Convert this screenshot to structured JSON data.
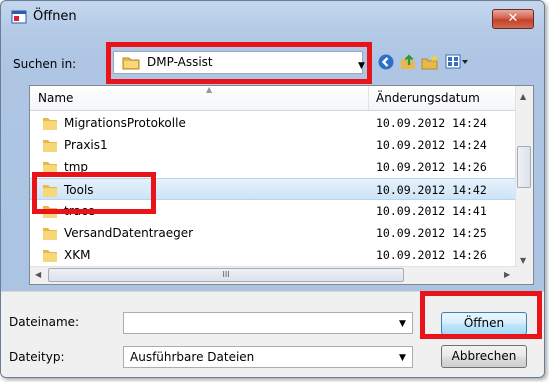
{
  "window": {
    "title": "Öffnen",
    "close_glyph": "✕"
  },
  "lookin": {
    "label": "Suchen in:",
    "value": "DMP-Assist"
  },
  "toolbar": {
    "icons": [
      "back-icon",
      "up-folder-icon",
      "new-folder-icon",
      "view-menu-icon"
    ]
  },
  "list": {
    "columns": [
      "Name",
      "Änderungsdatum"
    ],
    "rows": [
      {
        "name": "MigrationsProtokolle",
        "date": "10.09.2012 14:24"
      },
      {
        "name": "Praxis1",
        "date": "10.09.2012 14:24"
      },
      {
        "name": "tmp",
        "date": "10.09.2012 14:26"
      },
      {
        "name": "Tools",
        "date": "10.09.2012 14:42",
        "selected": true
      },
      {
        "name": "trace",
        "date": "10.09.2012 14:41"
      },
      {
        "name": "VersandDatentraeger",
        "date": "10.09.2012 14:25"
      },
      {
        "name": "XKM",
        "date": "10.09.2012 14:26"
      }
    ],
    "scroll_thumb_grip": "III"
  },
  "filename": {
    "label": "Dateiname:",
    "value": ""
  },
  "filetype": {
    "label": "Dateityp:",
    "value": "Ausführbare Dateien"
  },
  "buttons": {
    "open": "Öffnen",
    "cancel": "Abbrechen"
  },
  "colors": {
    "highlight": "#e8141a",
    "selection": "#cde4f7"
  }
}
